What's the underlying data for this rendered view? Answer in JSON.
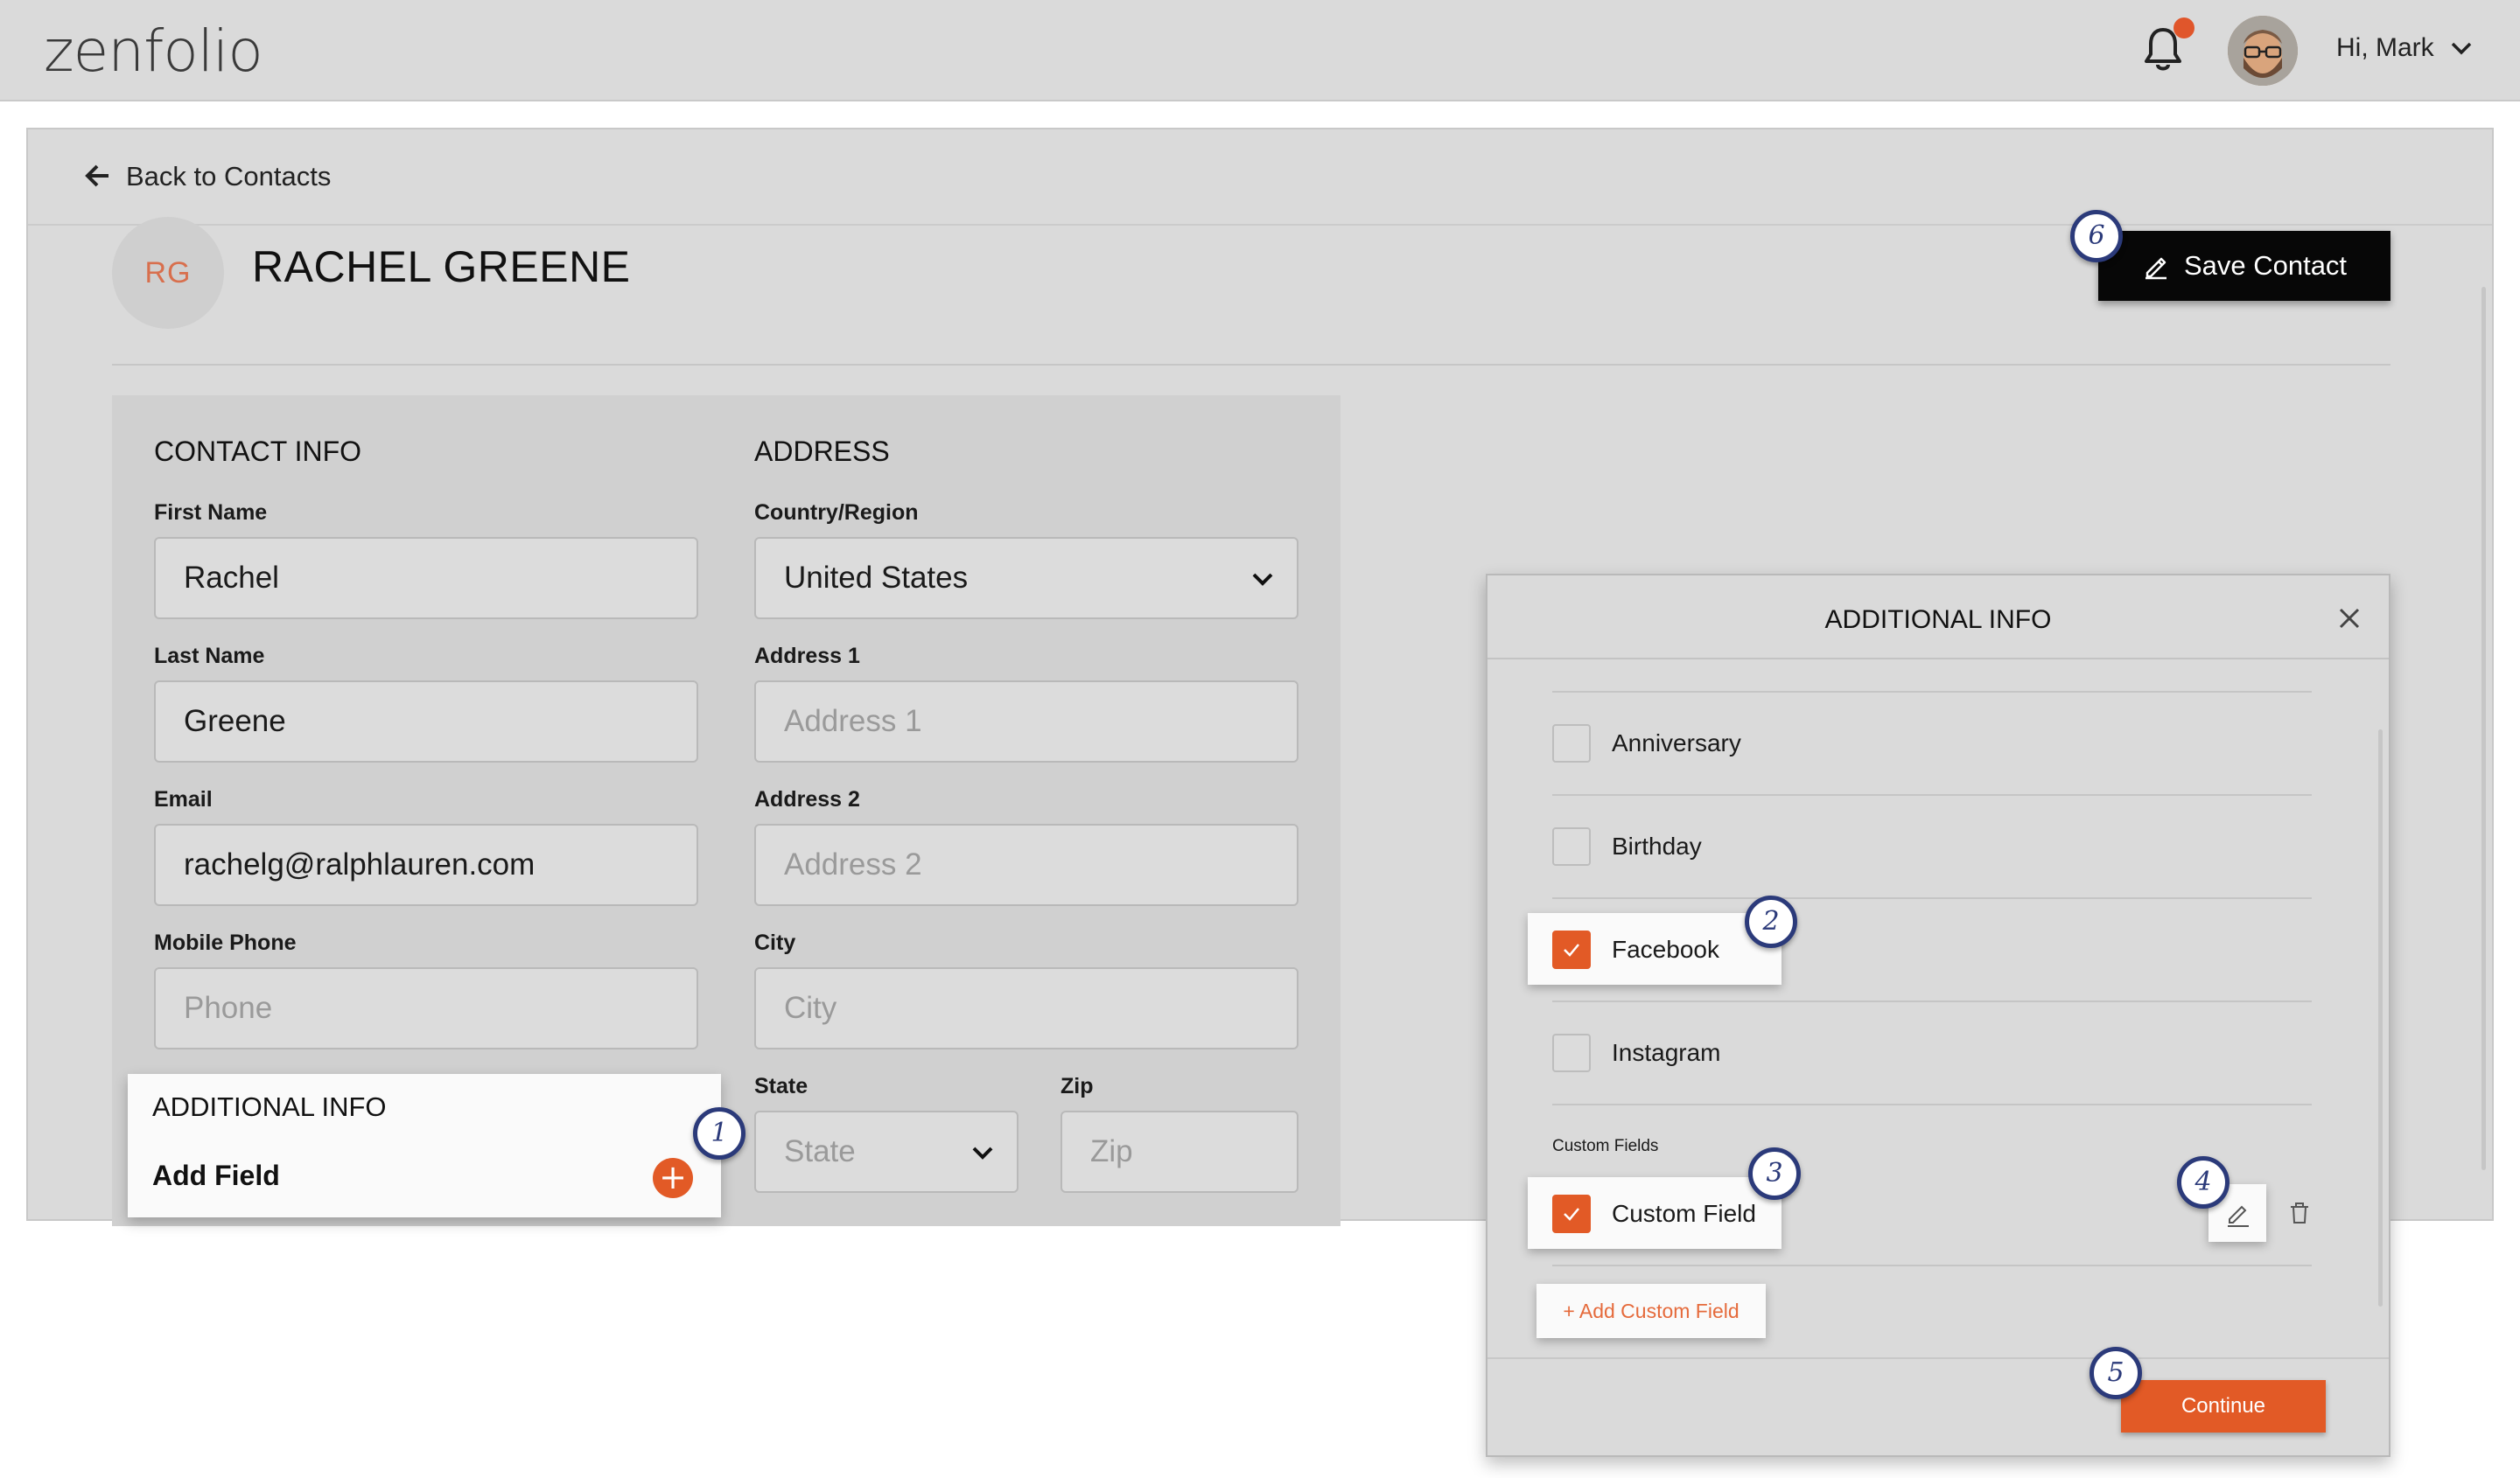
{
  "header": {
    "logo": "zenfolio",
    "greeting": "Hi, Mark"
  },
  "nav": {
    "back_label": "Back to Contacts"
  },
  "contact": {
    "initials": "RG",
    "name": "RACHEL GREENE",
    "save_label": "Save Contact"
  },
  "contact_info": {
    "title": "CONTACT INFO",
    "first_name_label": "First Name",
    "first_name_value": "Rachel",
    "last_name_label": "Last Name",
    "last_name_value": "Greene",
    "email_label": "Email",
    "email_value": "rachelg@ralphlauren.com",
    "mobile_label": "Mobile Phone",
    "mobile_placeholder": "Phone"
  },
  "address": {
    "title": "ADDRESS",
    "country_label": "Country/Region",
    "country_value": "United States",
    "address1_label": "Address 1",
    "address1_placeholder": "Address 1",
    "address2_label": "Address 2",
    "address2_placeholder": "Address 2",
    "city_label": "City",
    "city_placeholder": "City",
    "state_label": "State",
    "state_placeholder": "State",
    "zip_label": "Zip",
    "zip_placeholder": "Zip"
  },
  "additional_info_section": {
    "title": "ADDITIONAL INFO",
    "add_field_label": "Add Field"
  },
  "modal": {
    "title": "ADDITIONAL INFO",
    "options": [
      {
        "label": "Anniversary",
        "checked": false
      },
      {
        "label": "Birthday",
        "checked": false
      },
      {
        "label": "Facebook",
        "checked": true
      },
      {
        "label": "Instagram",
        "checked": false
      }
    ],
    "custom_fields_title": "Custom Fields",
    "custom_field": {
      "label": "Custom Field",
      "checked": true
    },
    "add_custom_label": "+ Add Custom Field",
    "continue_label": "Continue"
  },
  "badges": [
    "1",
    "2",
    "3",
    "4",
    "5",
    "6"
  ],
  "colors": {
    "accent": "#e25a26",
    "badge": "#2b3a7a",
    "save_button": "#070707"
  }
}
